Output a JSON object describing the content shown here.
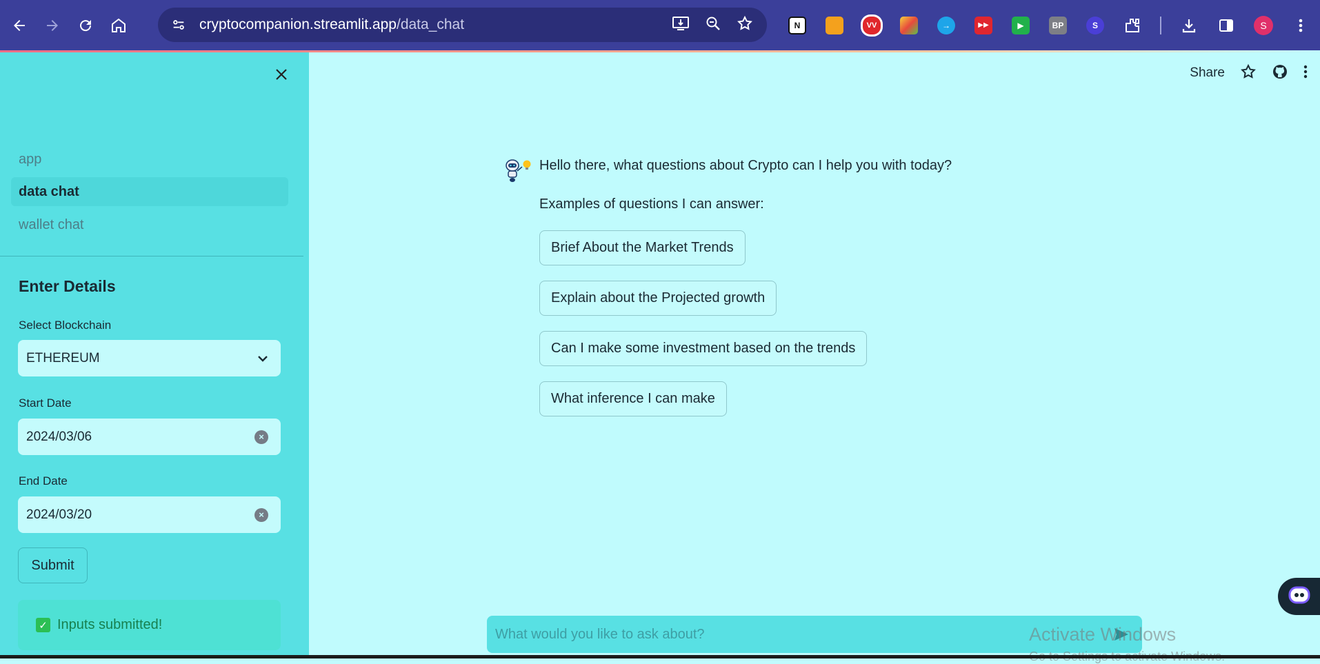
{
  "browser": {
    "url_host": "cryptocompanion.streamlit.app",
    "url_path": "/data_chat",
    "extensions": [
      {
        "name": "notion-icon",
        "label": "N",
        "bg": "#ffffff",
        "fg": "#111111"
      },
      {
        "name": "office-icon",
        "label": "",
        "bg": "#f4a11d",
        "fg": "#ffffff"
      },
      {
        "name": "vv-icon",
        "label": "VV",
        "bg": "#e0272b",
        "fg": "#ffffff"
      },
      {
        "name": "colorful-icon",
        "label": "",
        "bg": "#7ecb52",
        "fg": "#ffffff"
      },
      {
        "name": "arrow-extension-icon",
        "label": "→",
        "bg": "#1ea5e9",
        "fg": "#ffffff"
      },
      {
        "name": "video-forward-icon",
        "label": "▶▶",
        "bg": "#e0262f",
        "fg": "#ffffff"
      },
      {
        "name": "play-green-icon",
        "label": "▶",
        "bg": "#21b14b",
        "fg": "#ffffff"
      },
      {
        "name": "bp-icon",
        "label": "BP",
        "bg": "#7d7f86",
        "fg": "#ffffff"
      },
      {
        "name": "s-extension-icon",
        "label": "S",
        "bg": "#4a3fd6",
        "fg": "#ffffff"
      }
    ],
    "profile_initial": "S"
  },
  "sidebar": {
    "nav": [
      {
        "label": "app",
        "active": false
      },
      {
        "label": "data chat",
        "active": true
      },
      {
        "label": "wallet chat",
        "active": false
      }
    ],
    "heading": "Enter Details",
    "blockchain_label": "Select Blockchain",
    "blockchain_value": "ETHEREUM",
    "start_label": "Start Date",
    "start_value": "2024/03/06",
    "end_label": "End Date",
    "end_value": "2024/03/20",
    "submit_label": "Submit",
    "success_text": "Inputs submitted!"
  },
  "toolbar": {
    "share_label": "Share"
  },
  "chat": {
    "greeting": "Hello there, what questions about Crypto can I help you with today?",
    "examples_intro": "Examples of questions I can answer:",
    "examples": [
      "Brief About the Market Trends",
      "Explain about the Projected growth",
      "Can I make some investment based on the trends",
      "What inference I can make"
    ],
    "input_placeholder": "What would you like to ask about?"
  },
  "watermark": {
    "title": "Activate Windows",
    "subtitle": "Go to Settings to activate Windows."
  }
}
